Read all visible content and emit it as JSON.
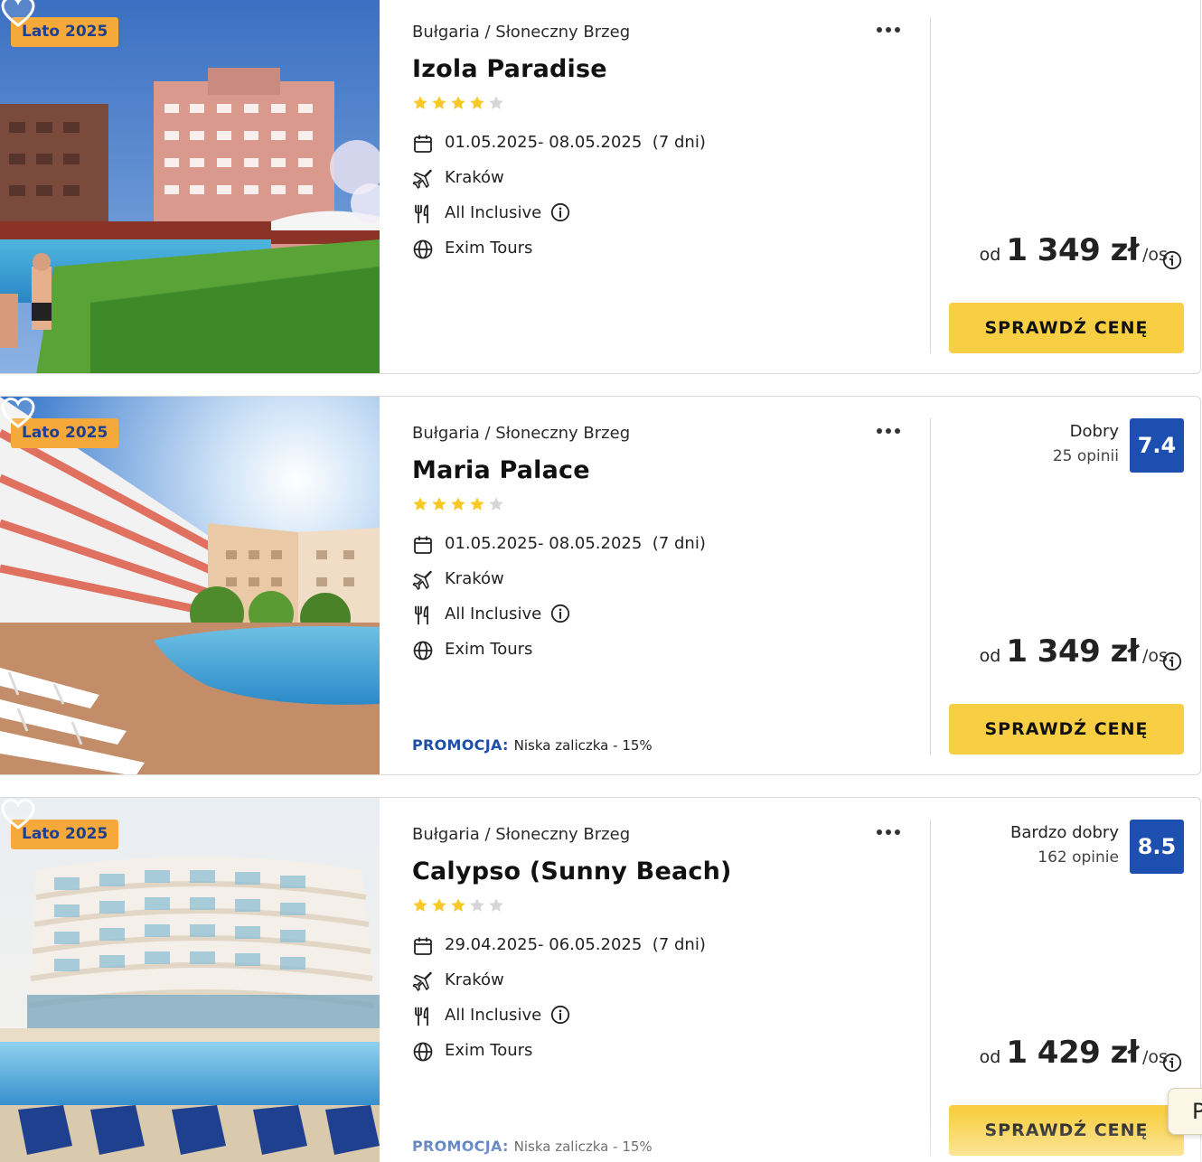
{
  "colors": {
    "badge_bg": "#f6a93b",
    "badge_text": "#1e3f8f",
    "star_on": "#f8c825",
    "star_off": "#d6d6d6",
    "button_bg": "#f8cf43",
    "score_bg": "#1d4fb0",
    "promo_label": "#1d4fa6"
  },
  "common": {
    "check_button_label": "SPRAWDŹ CENĘ",
    "price_prefix": "od",
    "price_suffix": "/os.",
    "promo_label": "PROMOCJA:"
  },
  "offers": [
    {
      "badge": "Lato 2025",
      "location": "Bułgaria / Słoneczny Brzeg",
      "name": "Izola Paradise",
      "stars": 4,
      "dates": "01.05.2025- 08.05.2025",
      "duration": "(7 dni)",
      "departure": "Kraków",
      "board": "All Inclusive",
      "operator": "Exim Tours",
      "price": "1 349 zł"
    },
    {
      "badge": "Lato 2025",
      "location": "Bułgaria / Słoneczny Brzeg",
      "name": "Maria Palace",
      "stars": 4,
      "dates": "01.05.2025- 08.05.2025",
      "duration": "(7 dni)",
      "departure": "Kraków",
      "board": "All Inclusive",
      "operator": "Exim Tours",
      "price": "1 349 zł",
      "rating_label": "Dobry",
      "rating_count": "25 opinii",
      "rating_score": "7.4",
      "promo": "Niska zaliczka - 15%"
    },
    {
      "badge": "Lato 2025",
      "location": "Bułgaria / Słoneczny Brzeg",
      "name": "Calypso (Sunny Beach)",
      "stars": 3,
      "dates": "29.04.2025- 06.05.2025",
      "duration": "(7 dni)",
      "departure": "Kraków",
      "board": "All Inclusive",
      "operator": "Exim Tours",
      "price": "1 429 zł",
      "rating_label": "Bardzo dobry",
      "rating_count": "162 opinie",
      "rating_score": "8.5",
      "promo": "Niska zaliczka - 15%"
    }
  ],
  "corner_chip": "P"
}
